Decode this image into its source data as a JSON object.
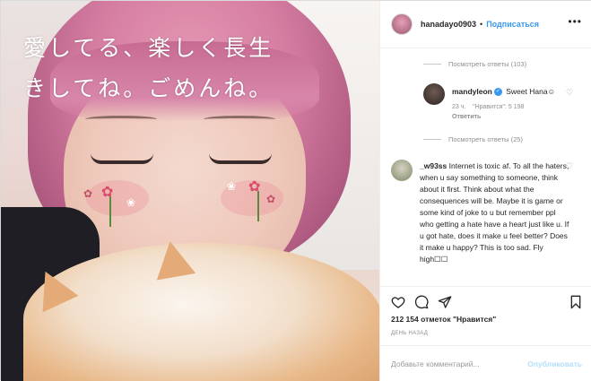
{
  "photo": {
    "caption_line1": "愛してる、楽しく長生",
    "caption_line2": "きしてね。ごめんね。"
  },
  "header": {
    "username": "hanadayo0903",
    "separator": "•",
    "follow_label": "Подписаться",
    "more_icon": "more-horizontal-icon"
  },
  "comments": {
    "view_replies_1": "Посмотреть ответы (103)",
    "reply": {
      "user": "mandyleon",
      "text": "Sweet Hana☺",
      "age": "23 ч.",
      "likes": "\"Нравится\": 5 198",
      "reply_label": "Ответить"
    },
    "view_replies_2": "Посмотреть ответы (25)",
    "comment": {
      "user": "_w93ss",
      "text": "Internet is toxic af. To all the haters, when u say something to someone, think about it first. Think about what the consequences will be. Maybe it is game or some kind of joke to u but remember ppl who getting a hate have a heart just like u. If u got hate, does it make u feel better? Does it make u happy? This is too sad. Fly high☐☐"
    }
  },
  "actions": {
    "like_icon": "heart-icon",
    "comment_icon": "comment-icon",
    "share_icon": "share-icon",
    "save_icon": "bookmark-icon"
  },
  "likes_text": "212 154 отметок \"Нравится\"",
  "timestamp": "ДЕНЬ НАЗАД",
  "add_comment": {
    "placeholder": "Добавьте комментарий...",
    "publish_label": "Опубликовать"
  },
  "colors": {
    "accent": "#3897f0",
    "publish_disabled": "#b2dffc",
    "muted": "#8e8e8e"
  }
}
